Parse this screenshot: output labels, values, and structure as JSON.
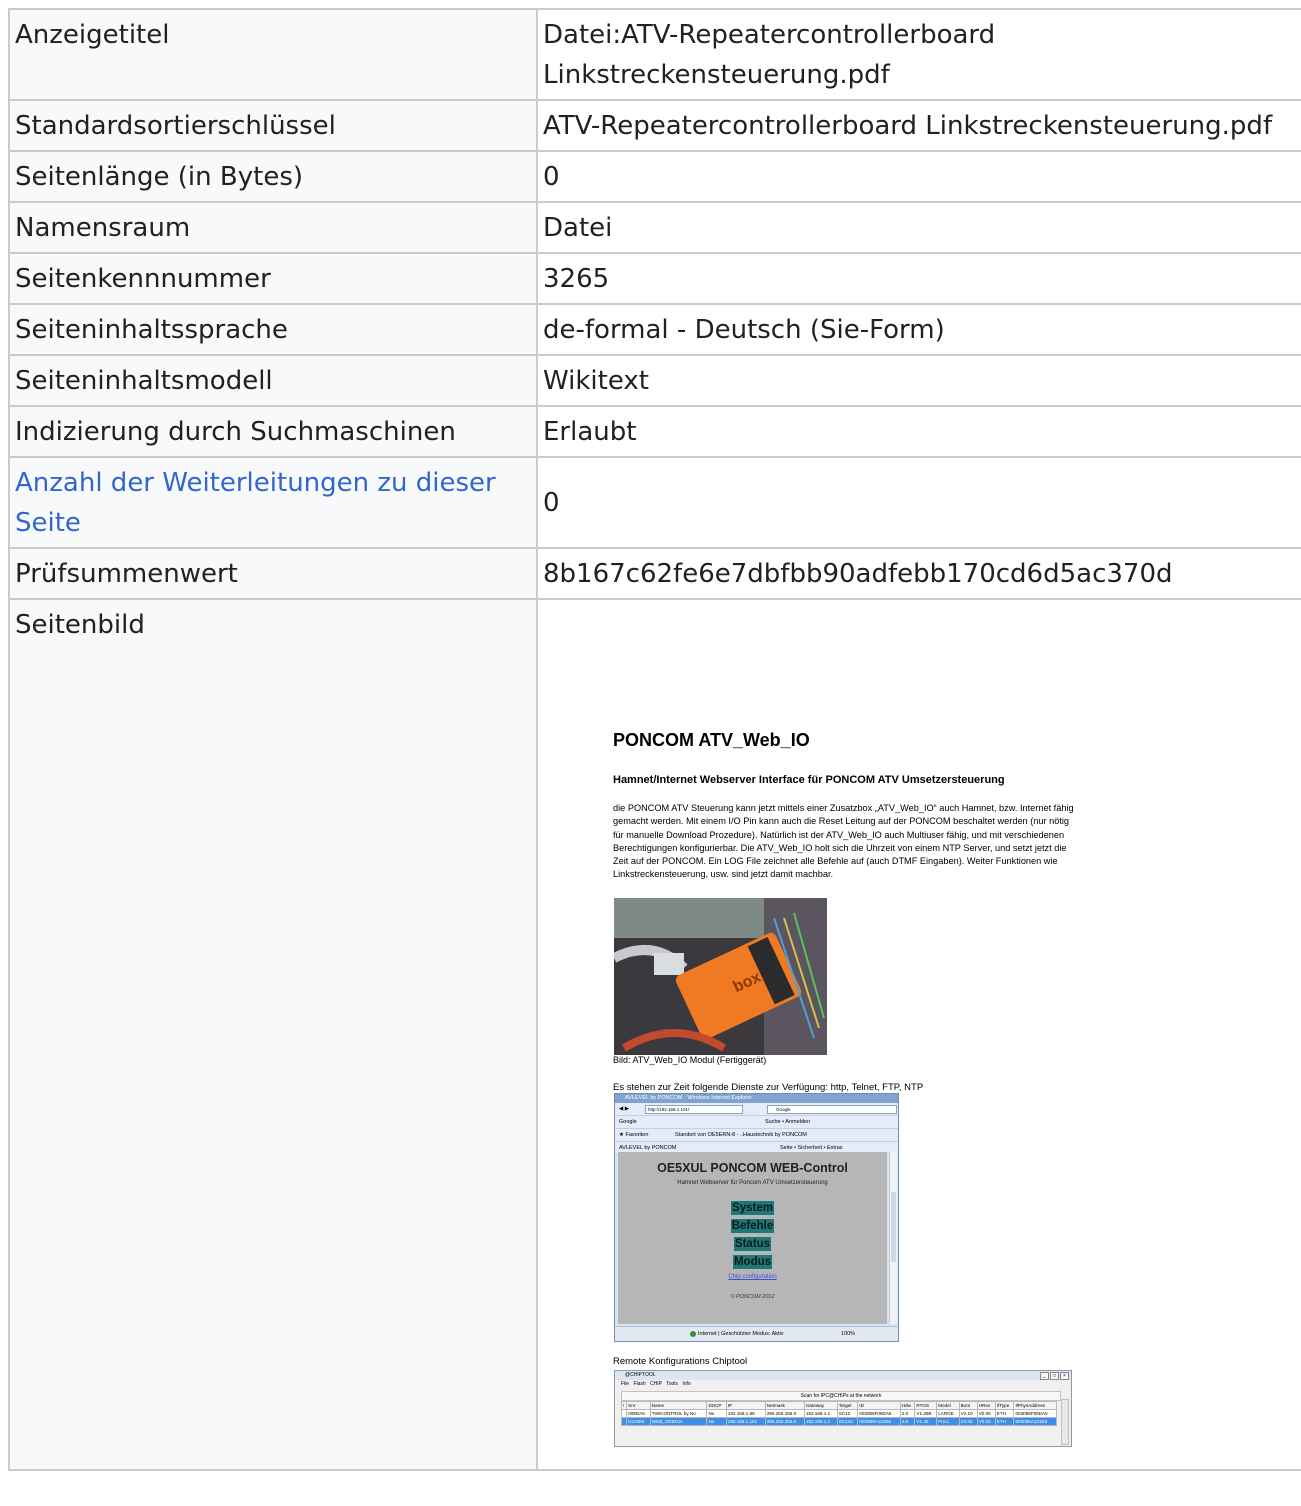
{
  "rows": [
    {
      "key": "Anzeigetitel",
      "value": "Datei:ATV-Repeatercontrollerboard Linkstreckensteuerung.pdf"
    },
    {
      "key": "Standardsortierschlüssel",
      "value": "ATV-Repeatercontrollerboard Linkstreckensteuerung.pdf"
    },
    {
      "key": "Seitenlänge (in Bytes)",
      "value": "0"
    },
    {
      "key": "Namensraum",
      "value": "Datei"
    },
    {
      "key": "Seitenkennnummer",
      "value": "3265"
    },
    {
      "key": "Seiteninhaltssprache",
      "value": "de-formal - Deutsch (Sie-Form)"
    },
    {
      "key": "Seiteninhaltsmodell",
      "value": "Wikitext"
    },
    {
      "key": "Indizierung durch Suchmaschinen",
      "value": "Erlaubt"
    },
    {
      "key": "Anzahl der Weiterleitungen zu dieser Seite",
      "value": "0"
    },
    {
      "key": "Prüfsummenwert",
      "value": "8b167c62fe6e7dbfbb90adfebb170cd6d5ac370d"
    },
    {
      "key": "Seitenbild",
      "value": ""
    }
  ],
  "pdf": {
    "title": "PONCOM ATV_Web_IO",
    "subtitle": "Hamnet/Internet Webserver Interface für PONCOM ATV Umsetzersteuerung",
    "body": "die PONCOM ATV Steuerung kann jetzt mittels einer Zusatzbox „ATV_Web_IO“ auch Hamnet, bzw. Internet fähig gemacht werden. Mit einem I/O Pin kann auch die Reset Leitung auf der PONCOM beschaltet werden (nur nötig für manuelle Download Prozedure). Natürlich ist der ATV_Web_IO auch Multiuser fähig, und mit verschiedenen Berechtigungen konfigurierbar. Die ATV_Web_IO holt sich die Uhrzeit von einem NTP Server, und setzt jetzt die Zeit auf der PONCOM. Ein LOG File zeichnet alle Befehle auf (auch DTMF Eingaben). Weiter Funktionen wie Linkstreckensteuerung, usw. sind jetzt damit machbar.",
    "photo_caption": "Bild: ATV_Web_IO Modul (Fertiggerät)",
    "services_caption": "Es stehen zur Zeit folgende Dienste zur Verfügung: http, Telnet, FTP, NTP",
    "chiptool_caption": "Remote Konfigurations Chiptool",
    "browser": {
      "window_title": "AVLEVEL by PONCOM - Windows Internet Explorer",
      "address": "http://192.168.1.101/",
      "search_engine": "Google",
      "toolbar_search": "Google",
      "toolbar_items": "Suche • Anmelden",
      "favorites": "Favoriten",
      "fav_item_1": "Standort von OE5ERN-8 - ...",
      "fav_item_2": "Haustechnik by PONCOM",
      "tab_label": "AVLEVEL by PONCOM",
      "cmd_items": "Seite • Sicherheit • Extras",
      "heading": "OE5XUL PONCOM WEB-Control",
      "subheading": "Hamnet Webserver für Poncom ATV Umsetzersteuerung",
      "buttons": [
        "System",
        "Befehle",
        "Status",
        "Modus"
      ],
      "link": "Chip configuration",
      "copyright": "© PONCOM 2012",
      "status": "Internet | Geschützter Modus: Aktiv",
      "zoom": "100%"
    },
    "chiptool": {
      "window_title": "@CHIPTOOL",
      "menu": [
        "File",
        "Flash",
        "CHIP",
        "Tools",
        "Info"
      ],
      "scan_label": "Scan for IPC@CHIPs at the network",
      "columns": [
        "!",
        "Snr",
        "Name",
        "DHCP",
        "IP",
        "Netmask",
        "Gateway",
        "Target",
        "ID",
        "Hdw",
        "RTOS",
        "Model",
        "Boot",
        "HRev",
        "IfType",
        "IfPhysAddress"
      ],
      "rows": [
        [
          "",
          "008DA5",
          "TWICONTROL by No",
          "No",
          "192.168.1.99",
          "255.255.255.0",
          "192.168.1.1",
          "SC12",
          "003056F08DA5",
          "2.0",
          "V1.25B",
          "LARGE",
          "V2.10",
          "V0.00",
          "ETH",
          "003056F08DA5"
        ],
        [
          "",
          "0131E6",
          "WEB_OE5XUL",
          "No",
          "192.168.1.101",
          "255.255.255.0",
          "192.168.1.1",
          "SC143",
          "003056A131E6",
          "2.0",
          "V1.40",
          "FULL",
          "V3.00",
          "V0.02",
          "ETH",
          "003056A131E6"
        ]
      ]
    }
  }
}
